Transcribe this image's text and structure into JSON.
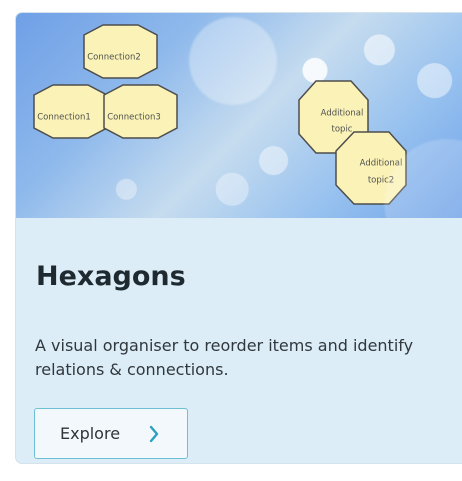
{
  "card": {
    "title": "Hexagons",
    "description": "A visual organiser to reorder items and identify relations & connections.",
    "button_label": "Explore",
    "button_icon": "chevron-right-icon"
  },
  "illustration": {
    "hexagons": [
      {
        "lines": [
          "Connection2"
        ]
      },
      {
        "lines": [
          "Connection1"
        ]
      },
      {
        "lines": [
          "Connection3"
        ]
      },
      {
        "lines": [
          "Additional",
          "topic"
        ]
      },
      {
        "lines": [
          "Additional",
          "topic2"
        ]
      }
    ]
  },
  "colors": {
    "hexagon_fill": "#fbf2b7",
    "hexagon_stroke": "#4d4d4d",
    "card_background": "#dcedf7",
    "button_border": "#6ec0d4",
    "chevron": "#2d9fc1"
  }
}
